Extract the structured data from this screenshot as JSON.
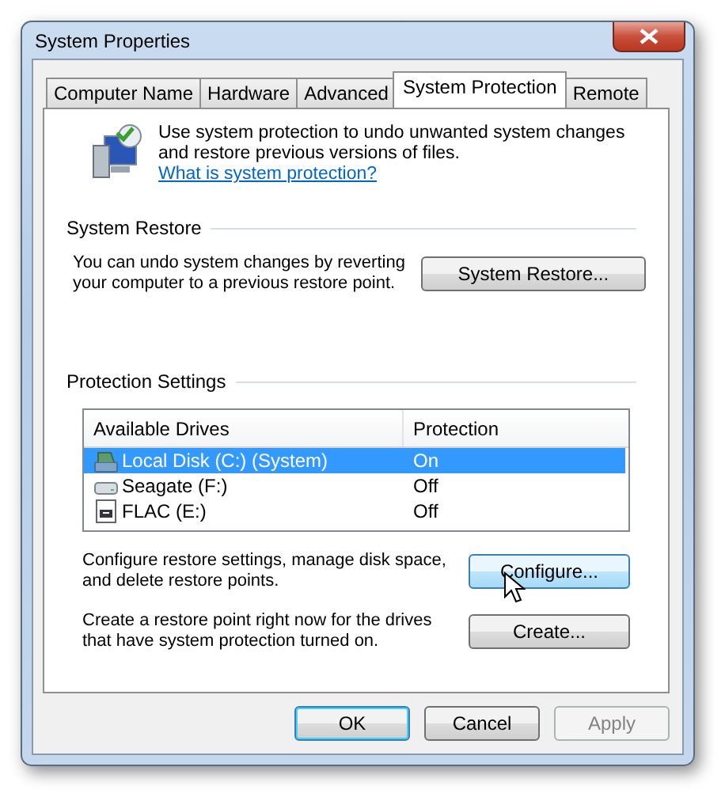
{
  "window": {
    "title": "System Properties"
  },
  "tabs": [
    {
      "label": "Computer Name",
      "selected": false
    },
    {
      "label": "Hardware",
      "selected": false
    },
    {
      "label": "Advanced",
      "selected": false
    },
    {
      "label": "System Protection",
      "selected": true
    },
    {
      "label": "Remote",
      "selected": false
    }
  ],
  "intro": {
    "text": "Use system protection to undo unwanted system changes and restore previous versions of files.",
    "link": "What is system protection?"
  },
  "system_restore": {
    "heading": "System Restore",
    "text": "You can undo system changes by reverting your computer to a previous restore point.",
    "button": {
      "label": "System Restore...",
      "default": false,
      "hovered": false,
      "disabled": false
    }
  },
  "protection_settings": {
    "heading": "Protection Settings",
    "columns": [
      "Available Drives",
      "Protection"
    ],
    "drives": [
      {
        "kind": "system",
        "name": "Local Disk (C:) (System)",
        "protection": "On",
        "selected": true
      },
      {
        "kind": "external",
        "name": "Seagate (F:)",
        "protection": "Off",
        "selected": false
      },
      {
        "kind": "media",
        "name": "FLAC (E:)",
        "protection": "Off",
        "selected": false
      }
    ],
    "actions": [
      {
        "text": "Configure restore settings, manage disk space, and delete restore points.",
        "button": {
          "label": "Configure...",
          "default": false,
          "hovered": true,
          "disabled": false
        }
      },
      {
        "text": "Create a restore point right now for the drives that have system protection turned on.",
        "button": {
          "label": "Create...",
          "default": false,
          "hovered": false,
          "disabled": false
        }
      }
    ]
  },
  "buttons": [
    {
      "label": "OK",
      "default": true,
      "hovered": false,
      "disabled": false
    },
    {
      "label": "Cancel",
      "default": false,
      "hovered": false,
      "disabled": false
    },
    {
      "label": "Apply",
      "default": false,
      "hovered": false,
      "disabled": true
    }
  ]
}
